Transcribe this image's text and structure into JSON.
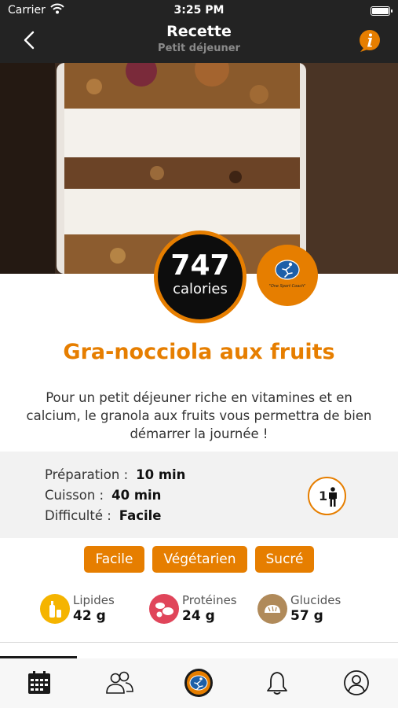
{
  "status_bar": {
    "carrier": "Carrier",
    "time": "3:25 PM"
  },
  "nav": {
    "title": "Recette",
    "subtitle": "Petit déjeuner"
  },
  "recipe": {
    "calories_value": "747",
    "calories_unit": "calories",
    "logo_caption": "\"One Sport Coach\"",
    "title": "Gra-nocciola aux fruits",
    "description": "Pour un petit déjeuner riche en vitamines et en calcium, le granola aux fruits vous permettra de bien démarrer la journée !",
    "details": {
      "preparation_label": "Préparation :",
      "preparation_value": "10 min",
      "cooking_label": "Cuisson :",
      "cooking_value": "40 min",
      "difficulty_label": "Difficulté :",
      "difficulty_value": "Facile"
    },
    "servings": "1",
    "tags": [
      "Facile",
      "Végétarien",
      "Sucré"
    ],
    "nutrients": [
      {
        "label": "Lipides",
        "value": "42 g",
        "color": "#f5b400",
        "icon": "oil-bottle-icon"
      },
      {
        "label": "Protéines",
        "value": "24 g",
        "color": "#e0455a",
        "icon": "protein-icon"
      },
      {
        "label": "Glucides",
        "value": "57 g",
        "color": "#b08a5a",
        "icon": "bread-icon"
      }
    ]
  },
  "colors": {
    "accent": "#e67e00",
    "dark_bar": "#232323"
  },
  "tab_bar": {
    "tabs": [
      {
        "icon": "calendar-icon"
      },
      {
        "icon": "community-icon"
      },
      {
        "icon": "coach-logo-icon"
      },
      {
        "icon": "bell-icon"
      },
      {
        "icon": "profile-icon"
      }
    ]
  }
}
